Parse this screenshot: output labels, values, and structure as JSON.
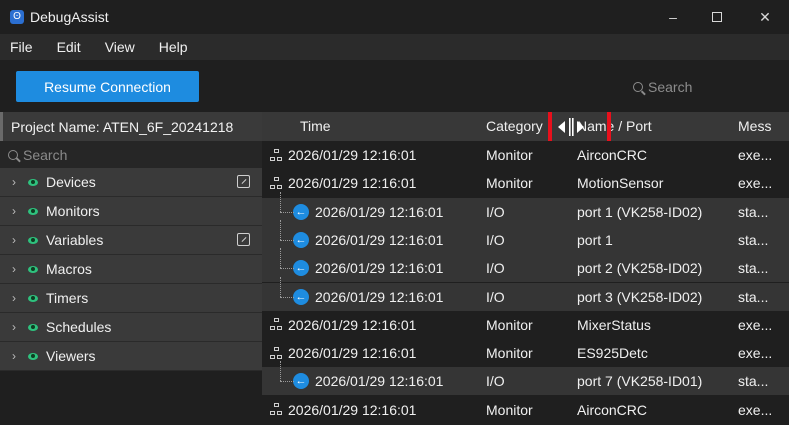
{
  "app": {
    "title": "DebugAssist",
    "icon_glyph": "ʘ",
    "window_controls": {
      "minimize": "–",
      "close": "✕"
    }
  },
  "menu": {
    "items": [
      "File",
      "Edit",
      "View",
      "Help"
    ]
  },
  "toolbar": {
    "resume_label": "Resume Connection",
    "search_placeholder": "Search",
    "accent_color": "#1e8ce0"
  },
  "sidebar": {
    "project_label": "Project Name: ATEN_6F_20241218",
    "search_placeholder": "Search",
    "items": [
      {
        "label": "Devices",
        "has_popout": true
      },
      {
        "label": "Monitors",
        "has_popout": false
      },
      {
        "label": "Variables",
        "has_popout": true
      },
      {
        "label": "Macros",
        "has_popout": false
      },
      {
        "label": "Timers",
        "has_popout": false
      },
      {
        "label": "Schedules",
        "has_popout": false
      },
      {
        "label": "Viewers",
        "has_popout": false
      }
    ]
  },
  "table": {
    "columns": {
      "time": "Time",
      "category": "Category",
      "name": "Name / Port",
      "message": "Mess"
    },
    "rows": [
      {
        "kind": "parent",
        "time": "2026/01/29 12:16:01",
        "category": "Monitor",
        "name": "AirconCRC",
        "message": "exe..."
      },
      {
        "kind": "parent",
        "time": "2026/01/29 12:16:01",
        "category": "Monitor",
        "name": "MotionSensor",
        "message": "exe..."
      },
      {
        "kind": "child",
        "time": "2026/01/29 12:16:01",
        "category": "I/O",
        "name": "port 1 (VK258-ID02)",
        "message": "sta..."
      },
      {
        "kind": "child",
        "time": "2026/01/29 12:16:01",
        "category": "I/O",
        "name": "port 1",
        "message": "sta..."
      },
      {
        "kind": "child",
        "time": "2026/01/29 12:16:01",
        "category": "I/O",
        "name": "port 2 (VK258-ID02)",
        "message": "sta..."
      },
      {
        "kind": "child",
        "time": "2026/01/29 12:16:01",
        "category": "I/O",
        "name": "port 3 (VK258-ID02)",
        "message": "sta..."
      },
      {
        "kind": "parent",
        "time": "2026/01/29 12:16:01",
        "category": "Monitor",
        "name": "MixerStatus",
        "message": "exe..."
      },
      {
        "kind": "parent",
        "time": "2026/01/29 12:16:01",
        "category": "Monitor",
        "name": "ES925Detc",
        "message": "exe..."
      },
      {
        "kind": "child",
        "time": "2026/01/29 12:16:01",
        "category": "I/O",
        "name": "port 7 (VK258-ID01)",
        "message": "sta..."
      },
      {
        "kind": "parent",
        "time": "2026/01/29 12:16:01",
        "category": "Monitor",
        "name": "AirconCRC",
        "message": "exe..."
      }
    ]
  },
  "icons": {
    "parent_row": "network-icon",
    "child_row": "io-arrow-icon",
    "column_resize": "column-resize-cursor-icon",
    "highlight_color": "#e8101c"
  }
}
